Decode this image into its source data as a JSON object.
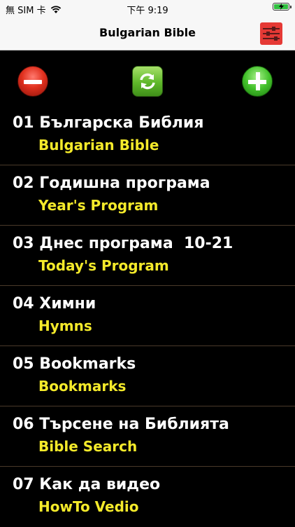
{
  "status_bar": {
    "carrier": "無 SIM 卡",
    "time": "下午 9:19",
    "wifi_icon": "wifi-icon",
    "battery_icon": "battery-charging-icon"
  },
  "nav": {
    "title": "Bulgarian Bible",
    "settings_icon": "settings-sliders-icon"
  },
  "toolbar": {
    "remove_icon": "minus-circle-icon",
    "refresh_icon": "refresh-icon",
    "add_icon": "plus-circle-icon"
  },
  "items": [
    {
      "title": "01 Българска Библия",
      "subtitle": "Bulgarian Bible"
    },
    {
      "title": "02 Годишна програма",
      "subtitle": "Year's Program"
    },
    {
      "title": "03 Днес програма  10-21",
      "subtitle": "Today's Program"
    },
    {
      "title": "04 Химни",
      "subtitle": "Hymns"
    },
    {
      "title": "05 Bookmarks",
      "subtitle": "Bookmarks"
    },
    {
      "title": "06 Търсене на Библията",
      "subtitle": "Bible Search"
    },
    {
      "title": "07 Как да видео",
      "subtitle": "HowTo Vedio"
    }
  ],
  "colors": {
    "background": "#000000",
    "title_text": "#ffffff",
    "subtitle_text": "#f4ea2a",
    "separator": "#4a3a2a"
  }
}
